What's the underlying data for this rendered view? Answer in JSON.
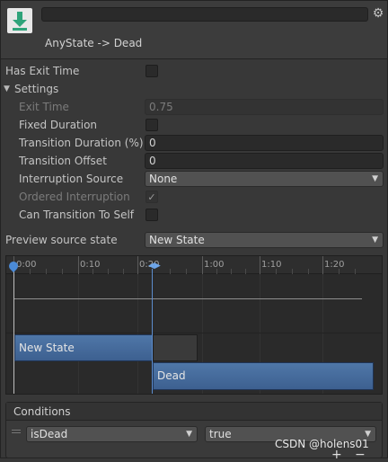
{
  "header": {
    "icon": "state-transition-download-icon",
    "name_value": "",
    "title": "AnyState -> Dead",
    "settings_icon": "gear-icon"
  },
  "properties": {
    "has_exit_time": {
      "label": "Has Exit Time",
      "checked": false
    },
    "settings_foldout": {
      "label": "Settings",
      "expanded": true
    },
    "exit_time": {
      "label": "Exit Time",
      "value": "0.75",
      "enabled": false
    },
    "fixed_duration": {
      "label": "Fixed Duration",
      "checked": false
    },
    "transition_duration": {
      "label": "Transition Duration (%)",
      "value": "0"
    },
    "transition_offset": {
      "label": "Transition Offset",
      "value": "0"
    },
    "interruption_source": {
      "label": "Interruption Source",
      "value": "None"
    },
    "ordered_interruption": {
      "label": "Ordered Interruption",
      "checked": true,
      "enabled": false
    },
    "can_transition_to_self": {
      "label": "Can Transition To Self",
      "checked": false
    },
    "preview_source_state": {
      "label": "Preview source state",
      "value": "New State"
    }
  },
  "timeline": {
    "ticks": [
      "0:00",
      "0:10",
      "0:20",
      "1:00",
      "1:10",
      "1:20"
    ],
    "source_state_bar": "New State",
    "target_state_bar": "Dead",
    "marker_color": "#4b8ad6",
    "bar_color": "#466c9c"
  },
  "conditions": {
    "title": "Conditions",
    "items": [
      {
        "parameter": "isDead",
        "value": "true"
      }
    ],
    "add_label": "+",
    "remove_label": "−"
  },
  "watermark": "CSDN @holens01"
}
